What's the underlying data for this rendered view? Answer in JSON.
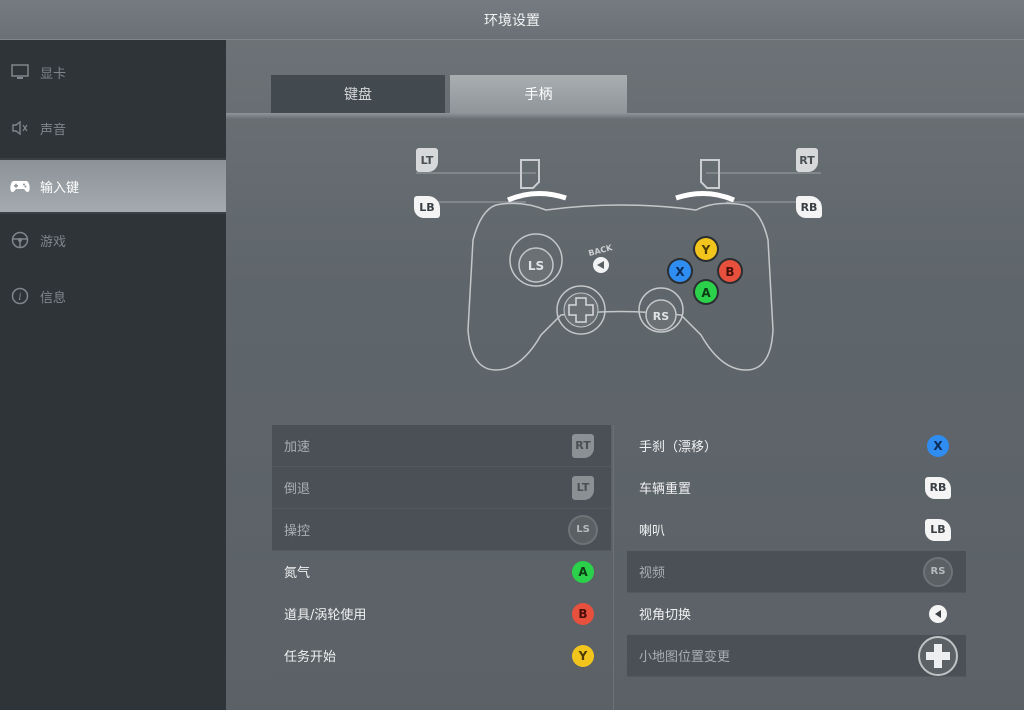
{
  "window": {
    "title": "环境设置"
  },
  "sidebar": {
    "items": [
      {
        "label": "显卡",
        "icon": "monitor-icon",
        "active": false
      },
      {
        "label": "声音",
        "icon": "speaker-icon",
        "active": false
      },
      {
        "label": "输入键",
        "icon": "gamepad-icon",
        "active": true
      },
      {
        "label": "游戏",
        "icon": "steering-wheel-icon",
        "active": false
      },
      {
        "label": "信息",
        "icon": "info-icon",
        "active": false
      }
    ]
  },
  "tabs": [
    {
      "label": "键盘",
      "active": false
    },
    {
      "label": "手柄",
      "active": true
    }
  ],
  "controller": {
    "lt": "LT",
    "rt": "RT",
    "lb": "LB",
    "rb": "RB",
    "ls": "LS",
    "rs": "RS",
    "back": "BACK",
    "y": "Y",
    "x": "X",
    "b": "B",
    "a": "A"
  },
  "bindings_left": [
    {
      "action": "加速",
      "button": "RT",
      "kind": "trigger",
      "dim": true
    },
    {
      "action": "倒退",
      "button": "LT",
      "kind": "trigger",
      "dim": true
    },
    {
      "action": "操控",
      "button": "LS",
      "kind": "stick",
      "dim": true
    },
    {
      "action": "氮气",
      "button": "A",
      "kind": "face"
    },
    {
      "action": "道具/涡轮使用",
      "button": "B",
      "kind": "face"
    },
    {
      "action": "任务开始",
      "button": "Y",
      "kind": "face"
    }
  ],
  "bindings_right": [
    {
      "action": "手刹（漂移）",
      "button": "X",
      "kind": "face"
    },
    {
      "action": "车辆重置",
      "button": "RB",
      "kind": "bumper"
    },
    {
      "action": "喇叭",
      "button": "LB",
      "kind": "bumper"
    },
    {
      "action": "视频",
      "button": "RS",
      "kind": "stick",
      "dim": true
    },
    {
      "action": "视角切换",
      "button": "back",
      "kind": "back"
    },
    {
      "action": "小地图位置变更",
      "button": "dpad",
      "kind": "dpad",
      "dim": true
    }
  ],
  "colors": {
    "sidebar_bg": "#2f3438",
    "active_item": "#a4aaae",
    "A": "#2bd14a",
    "B": "#e8503e",
    "Y": "#f2c51d",
    "X": "#2f8df2"
  }
}
